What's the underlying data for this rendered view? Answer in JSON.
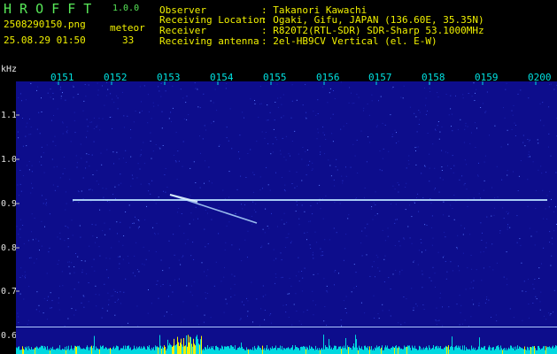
{
  "header": {
    "app_name": "H R O F F T",
    "version": "1.0.0",
    "filename": "2508290150.png",
    "meteor_label": "meteor",
    "datetime": "25.08.29 01:50",
    "meteor_count": "33",
    "info_labels": [
      "Observer",
      "Receiving Location",
      "Receiver",
      "Receiving antenna"
    ],
    "info_values": [
      ": Takanori Kawachi",
      ": Ogaki, Gifu, JAPAN (136.60E, 35.35N)",
      ": R820T2(RTL-SDR) SDR-Sharp 53.1000MHz",
      ": 2el-HB9CV Vertical (el. E-W)"
    ]
  },
  "axes": {
    "y_unit": "kHz",
    "x_ticks": [
      "0151",
      "0152",
      "0153",
      "0154",
      "0155",
      "0156",
      "0157",
      "0158",
      "0159",
      "0200"
    ],
    "y_ticks": [
      "1.1",
      "1.0",
      "0.9",
      "0.8",
      "0.7",
      "0.6"
    ]
  },
  "colors": {
    "title": "#58e858",
    "meta": "#f0f000",
    "labels": "#e8e8e8",
    "ticks": "#00dcdc",
    "background": "#0d0d8c",
    "signal": "#c8e8ff"
  }
}
